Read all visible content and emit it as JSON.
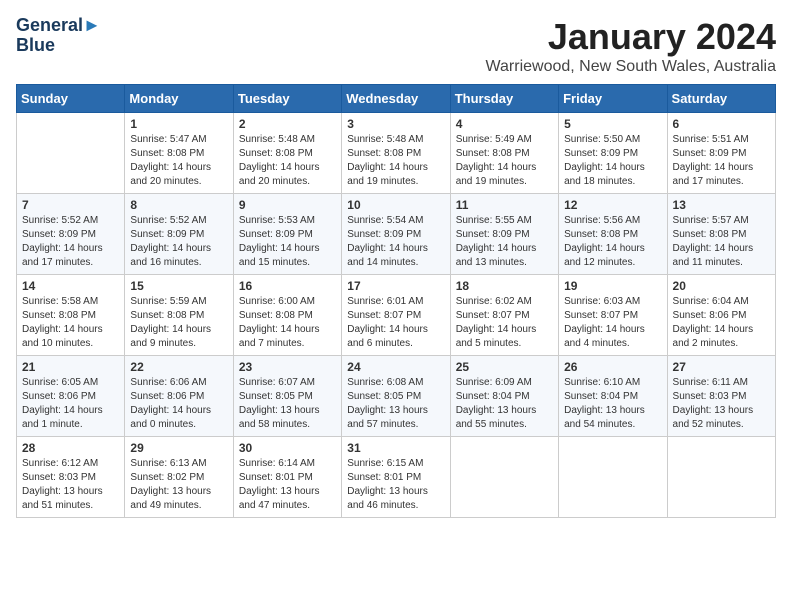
{
  "header": {
    "logo_line1": "General",
    "logo_line2": "Blue",
    "month_title": "January 2024",
    "location": "Warriewood, New South Wales, Australia"
  },
  "days_of_week": [
    "Sunday",
    "Monday",
    "Tuesday",
    "Wednesday",
    "Thursday",
    "Friday",
    "Saturday"
  ],
  "weeks": [
    [
      {
        "date": "",
        "sunrise": "",
        "sunset": "",
        "daylight": ""
      },
      {
        "date": "1",
        "sunrise": "Sunrise: 5:47 AM",
        "sunset": "Sunset: 8:08 PM",
        "daylight": "Daylight: 14 hours and 20 minutes."
      },
      {
        "date": "2",
        "sunrise": "Sunrise: 5:48 AM",
        "sunset": "Sunset: 8:08 PM",
        "daylight": "Daylight: 14 hours and 20 minutes."
      },
      {
        "date": "3",
        "sunrise": "Sunrise: 5:48 AM",
        "sunset": "Sunset: 8:08 PM",
        "daylight": "Daylight: 14 hours and 19 minutes."
      },
      {
        "date": "4",
        "sunrise": "Sunrise: 5:49 AM",
        "sunset": "Sunset: 8:08 PM",
        "daylight": "Daylight: 14 hours and 19 minutes."
      },
      {
        "date": "5",
        "sunrise": "Sunrise: 5:50 AM",
        "sunset": "Sunset: 8:09 PM",
        "daylight": "Daylight: 14 hours and 18 minutes."
      },
      {
        "date": "6",
        "sunrise": "Sunrise: 5:51 AM",
        "sunset": "Sunset: 8:09 PM",
        "daylight": "Daylight: 14 hours and 17 minutes."
      }
    ],
    [
      {
        "date": "7",
        "sunrise": "Sunrise: 5:52 AM",
        "sunset": "Sunset: 8:09 PM",
        "daylight": "Daylight: 14 hours and 17 minutes."
      },
      {
        "date": "8",
        "sunrise": "Sunrise: 5:52 AM",
        "sunset": "Sunset: 8:09 PM",
        "daylight": "Daylight: 14 hours and 16 minutes."
      },
      {
        "date": "9",
        "sunrise": "Sunrise: 5:53 AM",
        "sunset": "Sunset: 8:09 PM",
        "daylight": "Daylight: 14 hours and 15 minutes."
      },
      {
        "date": "10",
        "sunrise": "Sunrise: 5:54 AM",
        "sunset": "Sunset: 8:09 PM",
        "daylight": "Daylight: 14 hours and 14 minutes."
      },
      {
        "date": "11",
        "sunrise": "Sunrise: 5:55 AM",
        "sunset": "Sunset: 8:09 PM",
        "daylight": "Daylight: 14 hours and 13 minutes."
      },
      {
        "date": "12",
        "sunrise": "Sunrise: 5:56 AM",
        "sunset": "Sunset: 8:08 PM",
        "daylight": "Daylight: 14 hours and 12 minutes."
      },
      {
        "date": "13",
        "sunrise": "Sunrise: 5:57 AM",
        "sunset": "Sunset: 8:08 PM",
        "daylight": "Daylight: 14 hours and 11 minutes."
      }
    ],
    [
      {
        "date": "14",
        "sunrise": "Sunrise: 5:58 AM",
        "sunset": "Sunset: 8:08 PM",
        "daylight": "Daylight: 14 hours and 10 minutes."
      },
      {
        "date": "15",
        "sunrise": "Sunrise: 5:59 AM",
        "sunset": "Sunset: 8:08 PM",
        "daylight": "Daylight: 14 hours and 9 minutes."
      },
      {
        "date": "16",
        "sunrise": "Sunrise: 6:00 AM",
        "sunset": "Sunset: 8:08 PM",
        "daylight": "Daylight: 14 hours and 7 minutes."
      },
      {
        "date": "17",
        "sunrise": "Sunrise: 6:01 AM",
        "sunset": "Sunset: 8:07 PM",
        "daylight": "Daylight: 14 hours and 6 minutes."
      },
      {
        "date": "18",
        "sunrise": "Sunrise: 6:02 AM",
        "sunset": "Sunset: 8:07 PM",
        "daylight": "Daylight: 14 hours and 5 minutes."
      },
      {
        "date": "19",
        "sunrise": "Sunrise: 6:03 AM",
        "sunset": "Sunset: 8:07 PM",
        "daylight": "Daylight: 14 hours and 4 minutes."
      },
      {
        "date": "20",
        "sunrise": "Sunrise: 6:04 AM",
        "sunset": "Sunset: 8:06 PM",
        "daylight": "Daylight: 14 hours and 2 minutes."
      }
    ],
    [
      {
        "date": "21",
        "sunrise": "Sunrise: 6:05 AM",
        "sunset": "Sunset: 8:06 PM",
        "daylight": "Daylight: 14 hours and 1 minute."
      },
      {
        "date": "22",
        "sunrise": "Sunrise: 6:06 AM",
        "sunset": "Sunset: 8:06 PM",
        "daylight": "Daylight: 14 hours and 0 minutes."
      },
      {
        "date": "23",
        "sunrise": "Sunrise: 6:07 AM",
        "sunset": "Sunset: 8:05 PM",
        "daylight": "Daylight: 13 hours and 58 minutes."
      },
      {
        "date": "24",
        "sunrise": "Sunrise: 6:08 AM",
        "sunset": "Sunset: 8:05 PM",
        "daylight": "Daylight: 13 hours and 57 minutes."
      },
      {
        "date": "25",
        "sunrise": "Sunrise: 6:09 AM",
        "sunset": "Sunset: 8:04 PM",
        "daylight": "Daylight: 13 hours and 55 minutes."
      },
      {
        "date": "26",
        "sunrise": "Sunrise: 6:10 AM",
        "sunset": "Sunset: 8:04 PM",
        "daylight": "Daylight: 13 hours and 54 minutes."
      },
      {
        "date": "27",
        "sunrise": "Sunrise: 6:11 AM",
        "sunset": "Sunset: 8:03 PM",
        "daylight": "Daylight: 13 hours and 52 minutes."
      }
    ],
    [
      {
        "date": "28",
        "sunrise": "Sunrise: 6:12 AM",
        "sunset": "Sunset: 8:03 PM",
        "daylight": "Daylight: 13 hours and 51 minutes."
      },
      {
        "date": "29",
        "sunrise": "Sunrise: 6:13 AM",
        "sunset": "Sunset: 8:02 PM",
        "daylight": "Daylight: 13 hours and 49 minutes."
      },
      {
        "date": "30",
        "sunrise": "Sunrise: 6:14 AM",
        "sunset": "Sunset: 8:01 PM",
        "daylight": "Daylight: 13 hours and 47 minutes."
      },
      {
        "date": "31",
        "sunrise": "Sunrise: 6:15 AM",
        "sunset": "Sunset: 8:01 PM",
        "daylight": "Daylight: 13 hours and 46 minutes."
      },
      {
        "date": "",
        "sunrise": "",
        "sunset": "",
        "daylight": ""
      },
      {
        "date": "",
        "sunrise": "",
        "sunset": "",
        "daylight": ""
      },
      {
        "date": "",
        "sunrise": "",
        "sunset": "",
        "daylight": ""
      }
    ]
  ]
}
